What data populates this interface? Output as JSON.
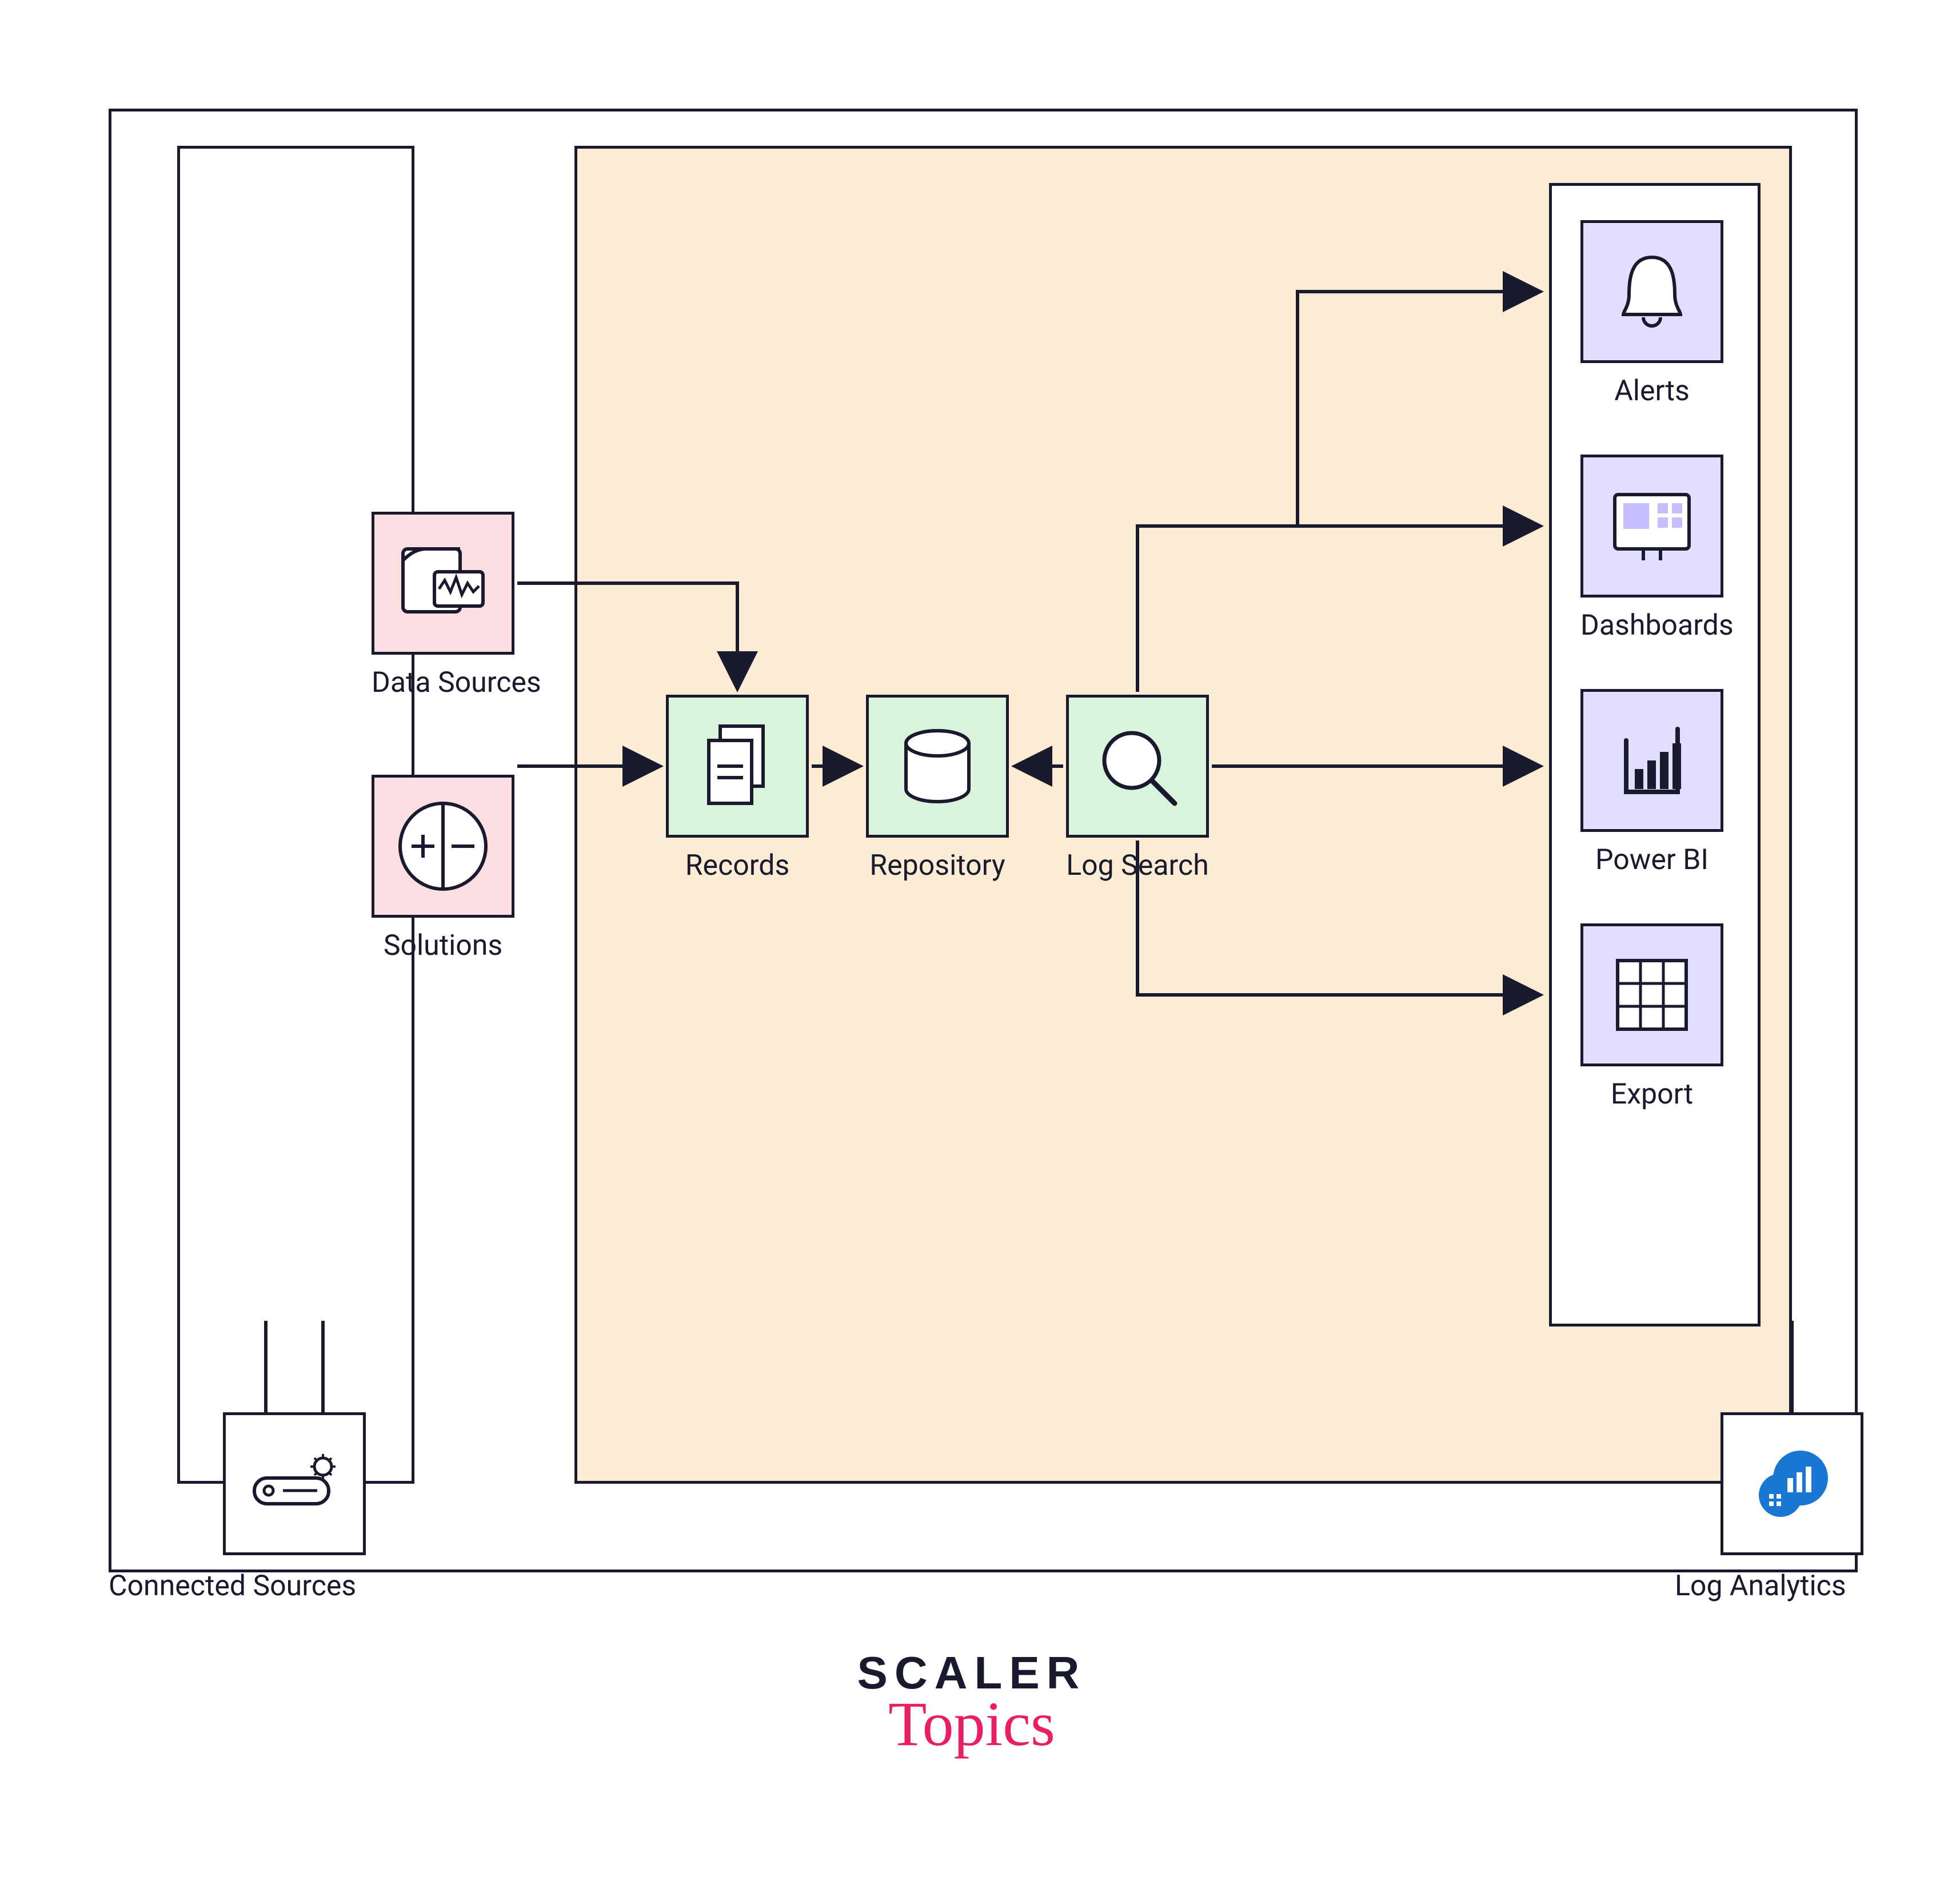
{
  "nodes": {
    "data_sources": "Data Sources",
    "solutions": "Solutions",
    "records": "Records",
    "repository": "Repository",
    "log_search": "Log Search",
    "alerts": "Alerts",
    "dashboards": "Dashboards",
    "power_bi": "Power BI",
    "export": "Export",
    "connected_sources": "Connected Sources",
    "log_analytics": "Log Analytics"
  },
  "branding": {
    "scaler": "SCALER",
    "topics": "Topics"
  },
  "diagram": {
    "edges": [
      {
        "from": "connected_sources",
        "to": "data_sources"
      },
      {
        "from": "connected_sources",
        "to": "solutions"
      },
      {
        "from": "data_sources",
        "to": "records"
      },
      {
        "from": "solutions",
        "to": "records"
      },
      {
        "from": "records",
        "to": "repository"
      },
      {
        "from": "log_search",
        "to": "repository"
      },
      {
        "from": "log_search",
        "to": "alerts"
      },
      {
        "from": "log_search",
        "to": "dashboards"
      },
      {
        "from": "log_search",
        "to": "power_bi"
      },
      {
        "from": "log_search",
        "to": "export"
      }
    ]
  }
}
